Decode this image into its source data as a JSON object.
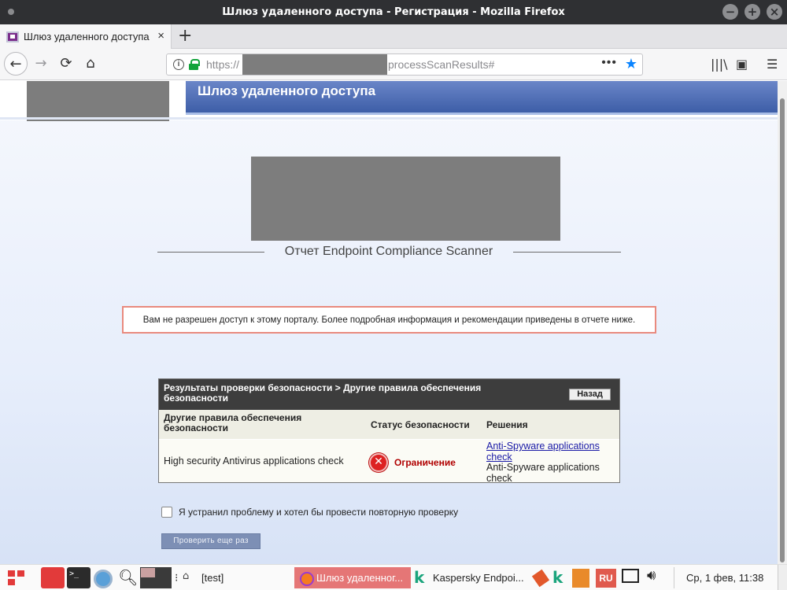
{
  "window": {
    "title": "Шлюз удаленного доступа - Регистрация - Mozilla Firefox",
    "buttons": [
      "−",
      "+",
      "×"
    ]
  },
  "tabs": [
    {
      "label": "Шлюз удаленного доступа",
      "close": "×"
    }
  ],
  "new_tab": "+",
  "nav": {
    "back": "←",
    "forward": "→",
    "reload": "⟳",
    "home": "⌂",
    "url_prefix": "https://",
    "url_suffix": "processScanResults#",
    "more": "•••",
    "bookmark_star": "★",
    "library": "|||\\",
    "sidebar": "▣",
    "menu": "☰"
  },
  "page": {
    "header_title": "Шлюз удаленного доступа",
    "report_title": "Отчет Endpoint Compliance Scanner",
    "alert_text": "Вам не разрешен доступ к этому порталу. Более подробная информация и рекомендации приведены в отчете ниже.",
    "results": {
      "path": "Результаты проверки безопасности > Другие правила обеспечения безопасности",
      "back_button": "Назад",
      "columns": [
        "Другие правила обеспечения безопасности",
        "Статус безопасности",
        "Решения"
      ],
      "rows": [
        {
          "rule": "High security Antivirus applications check",
          "status": "Ограничение",
          "status_color": "#b00000",
          "solution_link": "Anti-Spyware applications check",
          "solution_text": "Anti-Spyware applications check"
        }
      ]
    },
    "recheck_label": "Я устранил проблему и хотел бы провести повторную проверку",
    "recheck_button": "Проверить еще раз"
  },
  "taskbar": {
    "task_test": "[test]",
    "task_firefox": "Шлюз удаленног...",
    "task_kaspersky": "Kaspersky Endpoi...",
    "lang": "RU",
    "clock": "Ср, 1 фев, 11:38"
  }
}
